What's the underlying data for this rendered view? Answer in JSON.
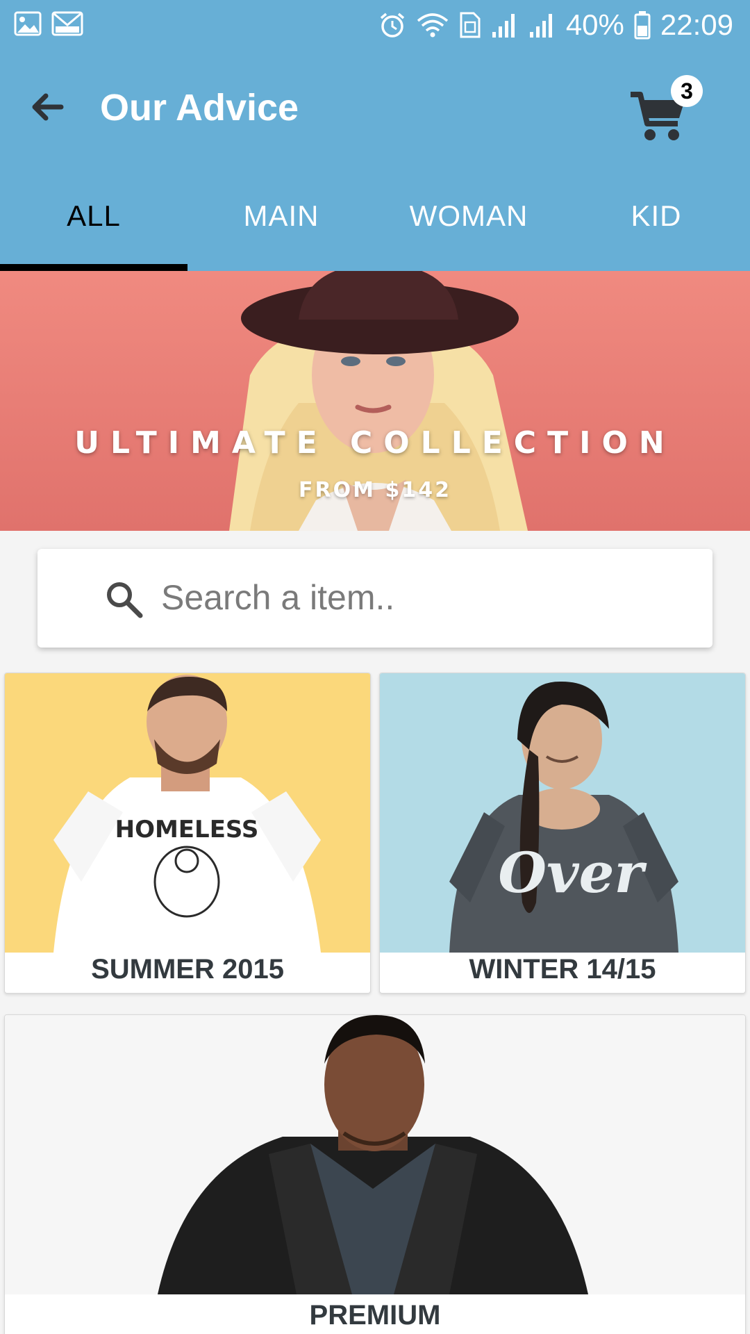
{
  "status_bar": {
    "battery": "40%",
    "time": "22:09",
    "left_icons": [
      "gallery-icon",
      "mail-icon"
    ],
    "right_icons": [
      "alarm-icon",
      "wifi-icon",
      "sim-icon",
      "signal-icon",
      "signal-icon",
      "battery-icon"
    ]
  },
  "toolbar": {
    "title": "Our Advice",
    "back_icon": "arrow-left-icon",
    "cart_icon": "shopping-cart-icon",
    "cart_count": "3"
  },
  "tabs": [
    {
      "label": "ALL",
      "active": true
    },
    {
      "label": "MAIN",
      "active": false
    },
    {
      "label": "WOMAN",
      "active": false
    },
    {
      "label": "KID",
      "active": false
    }
  ],
  "banner": {
    "title": "ULTIMATE COLLECTION",
    "subtitle": "FROM $142"
  },
  "search": {
    "placeholder": "Search a item..",
    "value": "",
    "icon": "search-icon"
  },
  "collections": [
    {
      "label": "SUMMER 2015",
      "shirt_text": "HOMELESS"
    },
    {
      "label": "WINTER 14/15",
      "shirt_text": "Over"
    },
    {
      "label": "PREMIUM"
    }
  ],
  "colors": {
    "primary": "#67afd6",
    "tab_indicator": "#000000",
    "banner_bg": "#e9807a",
    "summer_bg": "#fbd87b",
    "winter_bg": "#b3dbe6",
    "premium_bg": "#f6f6f6",
    "label_text": "#333a3f"
  }
}
